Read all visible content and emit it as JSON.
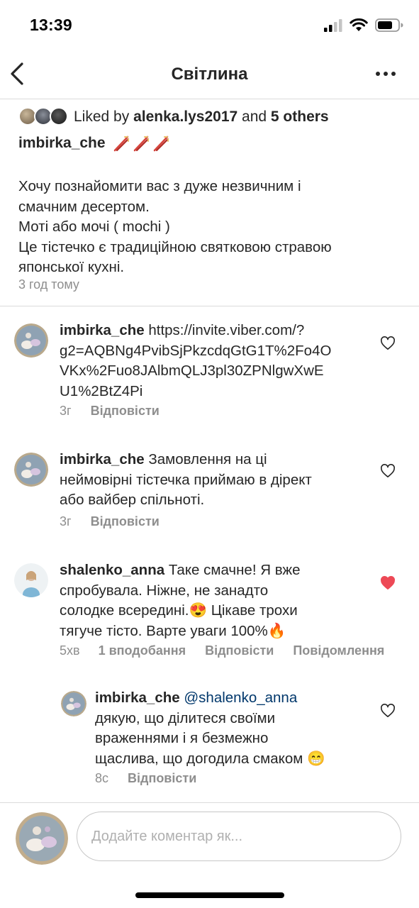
{
  "status_bar": {
    "time": "13:39"
  },
  "nav": {
    "title": "Світлина"
  },
  "post": {
    "likes_prefix": "Liked by ",
    "liked_by_user": "alenka.lys2017",
    "likes_and": " and ",
    "likes_others": "5 others",
    "author": "imbirka_che",
    "caption_lines": [
      "Хочу познайомити вас з дуже незвичним і\nсмачним десертом.",
      "Моті або мочі ( mochi )",
      "Це тістечко є традиційною святковою стравою\nяпонської кухні."
    ],
    "time": "3 год тому"
  },
  "comments": [
    {
      "user": "imbirka_che",
      "text": "https://invite.viber.com/?g2=AQBNg4PvibSjPkzcdqGtG1T%2Fo4OVKx%2Fuo8JAlbmQLJ3pl30ZPNlgwXwEU1%2BtZ4Pi",
      "text_lines": [
        " https://invite.viber.com/?",
        "g2=AQBNg4PvibSjPkzcdqGtG1T%2Fo4O",
        "VKx%2Fuo8JAlbmQLJ3pl30ZPNlgwXwE",
        "U1%2BtZ4Pi"
      ],
      "time": "3г",
      "reply": "Відповісти",
      "liked": false
    },
    {
      "user": "imbirka_che",
      "text_lines": [
        " Замовлення на ці",
        "неймовірні тістечка приймаю в дірект",
        "або вайбер спільноті."
      ],
      "time": "3г",
      "reply": "Відповісти",
      "liked": false
    },
    {
      "user": "shalenko_anna",
      "text_lines": [
        " Таке смачне! Я вже",
        "спробувала. Ніжне, не занадто",
        "солодке всередині.😍 Цікаве трохи",
        "тягуче тісто. Варте уваги 100%🔥"
      ],
      "time": "5хв",
      "likes": "1 вподобання",
      "reply": "Відповісти",
      "message": "Повідомлення",
      "liked": true
    },
    {
      "user": "imbirka_che",
      "mention": " @shalenko_anna",
      "text_lines": [
        "дякую, що ділитеся своїми",
        "враженнями і я безмежно",
        "щаслива, що догодила смаком 😁"
      ],
      "time": "8с",
      "reply": "Відповісти",
      "liked": false
    }
  ],
  "input": {
    "placeholder": "Додайте коментар як..."
  },
  "colors": {
    "text": "#262626",
    "muted": "#8e8e8e",
    "divider": "#dbdbdb",
    "heart_liked": "#ed4956",
    "mention": "#00376b"
  }
}
